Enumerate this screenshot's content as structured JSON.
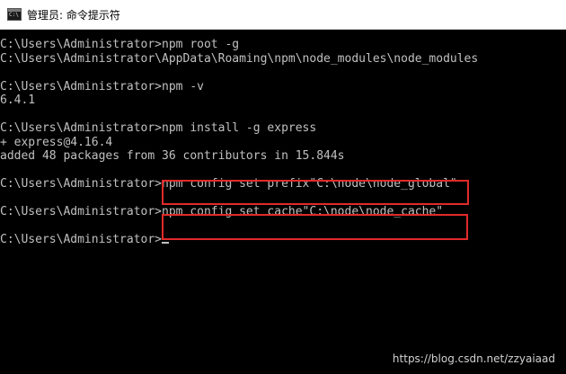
{
  "window": {
    "title": "管理员: 命令提示符",
    "icon_label": "C:\\",
    "icon": "command-prompt-icon"
  },
  "console": {
    "lines": [
      {
        "text": "C:\\Users\\Administrator>npm root -g"
      },
      {
        "text": "C:\\Users\\Administrator\\AppData\\Roaming\\npm\\node_modules\\node_modules"
      },
      {
        "text": ""
      },
      {
        "text": "C:\\Users\\Administrator>npm -v"
      },
      {
        "text": "6.4.1"
      },
      {
        "text": ""
      },
      {
        "text": "C:\\Users\\Administrator>npm install -g express"
      },
      {
        "text": "+ express@4.16.4"
      },
      {
        "text": "added 48 packages from 36 contributors in 15.844s"
      },
      {
        "text": ""
      },
      {
        "text": "C:\\Users\\Administrator>npm config set prefix\"C:\\node\\node_global\""
      },
      {
        "text": ""
      },
      {
        "text": "C:\\Users\\Administrator>npm config set cache\"C:\\node\\node_cache\""
      },
      {
        "text": ""
      },
      {
        "text": "C:\\Users\\Administrator>"
      }
    ]
  },
  "highlight_color": "#e12a2a",
  "watermark": "https://blog.csdn.net/zzyaiaad"
}
